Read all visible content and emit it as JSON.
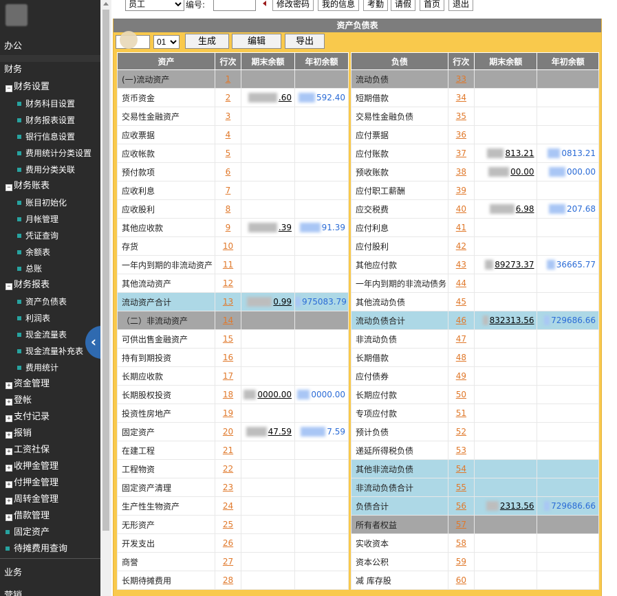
{
  "sidebar": {
    "office": "办公",
    "finance": "财务",
    "business": "业务",
    "sales": "营销",
    "collapse_glyph": "‹",
    "tree": [
      {
        "kind": "group",
        "expanded": true,
        "label": "财务设置"
      },
      {
        "kind": "leaf",
        "label": "财务科目设置"
      },
      {
        "kind": "leaf",
        "label": "财务报表设置"
      },
      {
        "kind": "leaf",
        "label": "银行信息设置"
      },
      {
        "kind": "leaf",
        "label": "费用统计分类设置"
      },
      {
        "kind": "leaf",
        "label": "费用分类关联"
      },
      {
        "kind": "group",
        "expanded": true,
        "label": "财务账表"
      },
      {
        "kind": "leaf",
        "label": "账目初始化"
      },
      {
        "kind": "leaf",
        "label": "月帐管理"
      },
      {
        "kind": "leaf",
        "label": "凭证查询"
      },
      {
        "kind": "leaf",
        "label": "余额表"
      },
      {
        "kind": "leaf",
        "label": "总账"
      },
      {
        "kind": "group",
        "expanded": true,
        "label": "财务报表"
      },
      {
        "kind": "leaf",
        "label": "资产负债表"
      },
      {
        "kind": "leaf",
        "label": "利润表"
      },
      {
        "kind": "leaf",
        "label": "现金流量表"
      },
      {
        "kind": "leaf",
        "label": "现金流量补充表"
      },
      {
        "kind": "leaf",
        "label": "费用统计"
      },
      {
        "kind": "group",
        "expanded": false,
        "label": "资金管理"
      },
      {
        "kind": "group",
        "expanded": false,
        "label": "登帐"
      },
      {
        "kind": "group",
        "expanded": false,
        "label": "支付记录"
      },
      {
        "kind": "group",
        "expanded": false,
        "label": "报销"
      },
      {
        "kind": "group",
        "expanded": false,
        "label": "工资社保"
      },
      {
        "kind": "group",
        "expanded": false,
        "label": "收押金管理"
      },
      {
        "kind": "group",
        "expanded": false,
        "label": "付押金管理"
      },
      {
        "kind": "group",
        "expanded": false,
        "label": "周转金管理"
      },
      {
        "kind": "group",
        "expanded": false,
        "label": "借款管理"
      },
      {
        "kind": "item",
        "label": "固定资产"
      },
      {
        "kind": "item",
        "label": "待摊费用查询"
      }
    ]
  },
  "toolbar": {
    "role_value": "员工",
    "no_label": "编号:",
    "no_value": "",
    "change_password": "修改密码",
    "my_info": "我的信息",
    "attendance": "考勤",
    "leave": "请假",
    "home": "首页",
    "logout": "退出"
  },
  "sheet": {
    "title": "资产负债表",
    "year_value": "",
    "month_value": "01",
    "generate": "生成",
    "edit": "编辑",
    "export": "导出",
    "left_headers": {
      "item": "资产",
      "row": "行次",
      "end": "期末余额",
      "begin": "年初余额"
    },
    "right_headers": {
      "item": "负债",
      "row": "行次",
      "end": "期末余额",
      "begin": "年初余额"
    },
    "left_rows": [
      {
        "name": "(一)流动资产",
        "num": "1",
        "type": "section",
        "end": "",
        "begin": ""
      },
      {
        "name": "货币资金",
        "num": "2",
        "end": ".60",
        "begin": "592.40"
      },
      {
        "name": "交易性金融资产",
        "num": "3",
        "end": "",
        "begin": ""
      },
      {
        "name": "应收票据",
        "num": "4",
        "end": "",
        "begin": ""
      },
      {
        "name": "应收帐款",
        "num": "5",
        "end": "",
        "begin": ""
      },
      {
        "name": "预付款项",
        "num": "6",
        "end": "",
        "begin": ""
      },
      {
        "name": "应收利息",
        "num": "7",
        "end": "",
        "begin": ""
      },
      {
        "name": "应收股利",
        "num": "8",
        "end": "",
        "begin": ""
      },
      {
        "name": "其他应收款",
        "num": "9",
        "end": ".39",
        "begin": "91.39"
      },
      {
        "name": "存货",
        "num": "10",
        "end": "",
        "begin": ""
      },
      {
        "name": "一年内到期的非流动资产",
        "num": "11",
        "end": "",
        "begin": ""
      },
      {
        "name": "其他流动资产",
        "num": "12",
        "end": "",
        "begin": ""
      },
      {
        "name": "流动资产合计",
        "num": "13",
        "type": "total",
        "end": "0.99",
        "begin": "975083.79"
      },
      {
        "name": "（二）非流动资产",
        "num": "14",
        "type": "section",
        "end": "",
        "begin": ""
      },
      {
        "name": "可供出售金融资产",
        "num": "15",
        "end": "",
        "begin": ""
      },
      {
        "name": "持有到期投资",
        "num": "16",
        "end": "",
        "begin": ""
      },
      {
        "name": "长期应收款",
        "num": "17",
        "end": "",
        "begin": ""
      },
      {
        "name": "长期股权投资",
        "num": "18",
        "end": "0000.00",
        "begin": "0000.00"
      },
      {
        "name": "投资性房地产",
        "num": "19",
        "end": "",
        "begin": ""
      },
      {
        "name": "固定资产",
        "num": "20",
        "end": "47.59",
        "begin": "7.59"
      },
      {
        "name": "在建工程",
        "num": "21",
        "end": "",
        "begin": ""
      },
      {
        "name": "工程物资",
        "num": "22",
        "end": "",
        "begin": ""
      },
      {
        "name": "固定资产清理",
        "num": "23",
        "end": "",
        "begin": ""
      },
      {
        "name": "生产性生物资产",
        "num": "24",
        "end": "",
        "begin": ""
      },
      {
        "name": "无形资产",
        "num": "25",
        "end": "",
        "begin": ""
      },
      {
        "name": "开发支出",
        "num": "26",
        "end": "",
        "begin": ""
      },
      {
        "name": "商誉",
        "num": "27",
        "end": "",
        "begin": ""
      },
      {
        "name": "长期待摊费用",
        "num": "28",
        "end": "",
        "begin": ""
      }
    ],
    "right_rows": [
      {
        "name": "流动负债",
        "num": "33",
        "type": "section",
        "end": "",
        "begin": ""
      },
      {
        "name": "短期借款",
        "num": "34",
        "end": "",
        "begin": ""
      },
      {
        "name": "交易性金融负债",
        "num": "35",
        "end": "",
        "begin": ""
      },
      {
        "name": "应付票据",
        "num": "36",
        "end": "",
        "begin": ""
      },
      {
        "name": "应付账款",
        "num": "37",
        "end": "813.21",
        "begin": "0813.21"
      },
      {
        "name": "预收账款",
        "num": "38",
        "end": "00.00",
        "begin": "000.00"
      },
      {
        "name": "应付职工薪酬",
        "num": "39",
        "end": "",
        "begin": ""
      },
      {
        "name": "应交税费",
        "num": "40",
        "end": "6.98",
        "begin": "207.68"
      },
      {
        "name": "应付利息",
        "num": "41",
        "end": "",
        "begin": ""
      },
      {
        "name": "应付股利",
        "num": "42",
        "end": "",
        "begin": ""
      },
      {
        "name": "其他应付款",
        "num": "43",
        "end": "89273.37",
        "begin": "36665.77"
      },
      {
        "name": "一年内到期的非流动债务",
        "num": "44",
        "end": "",
        "begin": ""
      },
      {
        "name": "其他流动负债",
        "num": "45",
        "end": "",
        "begin": ""
      },
      {
        "name": "流动负债合计",
        "num": "46",
        "type": "total",
        "end": "832313.56",
        "begin": "729686.66"
      },
      {
        "name": "非流动负债",
        "num": "47",
        "end": "",
        "begin": ""
      },
      {
        "name": "长期借款",
        "num": "48",
        "end": "",
        "begin": ""
      },
      {
        "name": "应付债券",
        "num": "49",
        "end": "",
        "begin": ""
      },
      {
        "name": "长期应付款",
        "num": "50",
        "end": "",
        "begin": ""
      },
      {
        "name": "专项应付款",
        "num": "51",
        "end": "",
        "begin": ""
      },
      {
        "name": "预计负债",
        "num": "52",
        "end": "",
        "begin": ""
      },
      {
        "name": "递延所得税负债",
        "num": "53",
        "end": "",
        "begin": ""
      },
      {
        "name": "其他非流动负债",
        "num": "54",
        "type": "total",
        "end": "",
        "begin": ""
      },
      {
        "name": "非流动负债合计",
        "num": "55",
        "type": "total",
        "end": "",
        "begin": ""
      },
      {
        "name": "负债合计",
        "num": "56",
        "type": "total",
        "end": "2313.56",
        "begin": "729686.66"
      },
      {
        "name": "所有者权益",
        "num": "57",
        "type": "section",
        "end": "",
        "begin": ""
      },
      {
        "name": "实收资本",
        "num": "58",
        "end": "",
        "begin": ""
      },
      {
        "name": "资本公积",
        "num": "59",
        "end": "",
        "begin": ""
      },
      {
        "name": "减 库存股",
        "num": "60",
        "end": "",
        "begin": ""
      }
    ]
  }
}
